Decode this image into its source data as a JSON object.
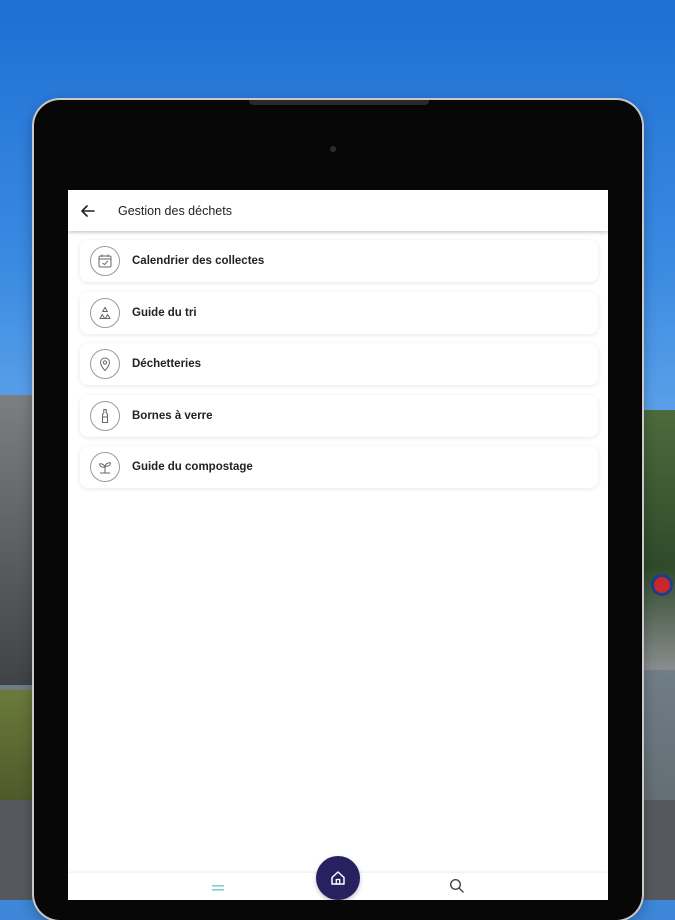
{
  "app_bar": {
    "back_icon": "arrow-left-icon",
    "title": "Gestion des déchets"
  },
  "menu": {
    "items": [
      {
        "label": "Calendrier des collectes",
        "icon": "calendar-check-icon"
      },
      {
        "label": "Guide du tri",
        "icon": "recycle-icon"
      },
      {
        "label": "Déchetteries",
        "icon": "map-pin-icon"
      },
      {
        "label": "Bornes à verre",
        "icon": "bottle-icon"
      },
      {
        "label": "Guide du compostage",
        "icon": "sprout-icon"
      }
    ]
  },
  "bottom_nav": {
    "menu_icon": "hamburger-menu-icon",
    "home_icon": "home-icon",
    "search_icon": "search-icon"
  },
  "colors": {
    "accent": "#27225f",
    "menu_icon_color": "#7fd0c8"
  }
}
